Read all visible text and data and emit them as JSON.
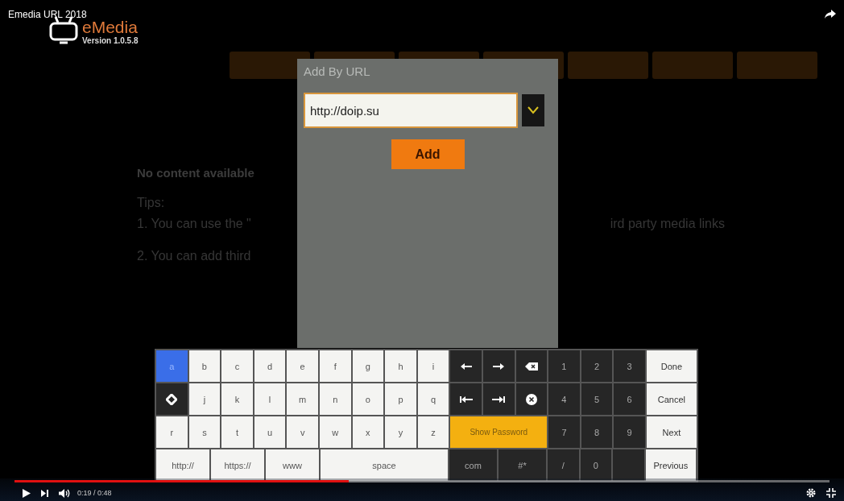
{
  "video": {
    "title": "Emedia URL 2018"
  },
  "app": {
    "name": "eMedia",
    "version": "Version 1.0.5.8"
  },
  "background": {
    "empty_message": "No content available",
    "tips_heading": "Tips:",
    "tip_1_left": "1. You can use the \"",
    "tip_1_right": "ird party media links",
    "tip_2": "2. You can add third"
  },
  "dialog": {
    "title": "Add By URL",
    "url_value": "http://doip.su",
    "add_button": "Add"
  },
  "keyboard": {
    "letter_rows": [
      [
        {
          "label": "a",
          "selected": true
        },
        {
          "label": "b",
          "selected": false
        },
        {
          "label": "c",
          "selected": false
        },
        {
          "label": "d",
          "selected": false
        },
        {
          "label": "e",
          "selected": false
        },
        {
          "label": "f",
          "selected": false
        },
        {
          "label": "g",
          "selected": false
        },
        {
          "label": "h",
          "selected": false
        },
        {
          "label": "i",
          "selected": false
        }
      ],
      [
        {
          "label": "j",
          "selected": false
        },
        {
          "label": "k",
          "selected": false
        },
        {
          "label": "l",
          "selected": false
        },
        {
          "label": "m",
          "selected": false
        },
        {
          "label": "n",
          "selected": false
        },
        {
          "label": "o",
          "selected": false
        },
        {
          "label": "p",
          "selected": false
        },
        {
          "label": "q",
          "selected": false
        }
      ],
      [
        {
          "label": "r",
          "selected": false
        },
        {
          "label": "s",
          "selected": false
        },
        {
          "label": "t",
          "selected": false
        },
        {
          "label": "u",
          "selected": false
        },
        {
          "label": "v",
          "selected": false
        },
        {
          "label": "w",
          "selected": false
        },
        {
          "label": "x",
          "selected": false
        },
        {
          "label": "y",
          "selected": false
        },
        {
          "label": "z",
          "selected": false
        }
      ]
    ],
    "show_password": "Show Password",
    "digit_rows": [
      [
        "1",
        "2",
        "3"
      ],
      [
        "4",
        "5",
        "6"
      ],
      [
        "7",
        "8",
        "9"
      ]
    ],
    "bottom_keys": [
      {
        "label": "http://",
        "kind": "prefix"
      },
      {
        "label": "https://",
        "kind": "prefix"
      },
      {
        "label": "www",
        "kind": "prefix"
      },
      {
        "label": "space",
        "kind": "space"
      },
      {
        "label": "com",
        "kind": "suffix"
      },
      {
        "label": "#*",
        "kind": "suffix"
      },
      {
        "label": "/",
        "kind": "digit"
      },
      {
        "label": "0",
        "kind": "digit"
      }
    ],
    "actions": [
      "Done",
      "Cancel",
      "Next",
      "Previous"
    ]
  },
  "player": {
    "time": "0:19 / 0:48",
    "level": 0.41
  }
}
